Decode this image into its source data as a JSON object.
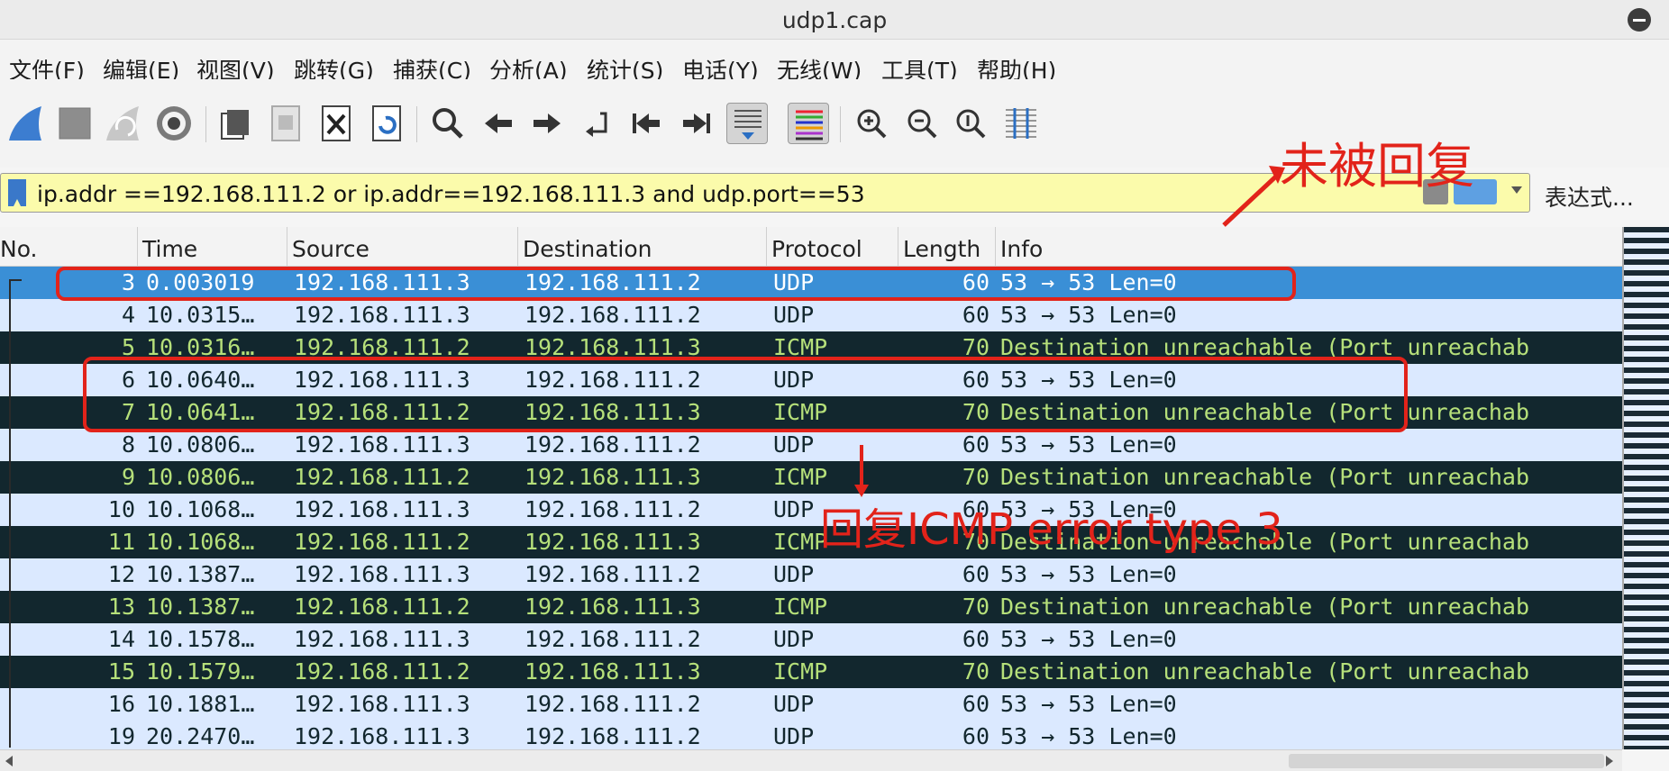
{
  "window": {
    "title": "udp1.cap"
  },
  "menu": [
    "文件(F)",
    "编辑(E)",
    "视图(V)",
    "跳转(G)",
    "捕获(C)",
    "分析(A)",
    "统计(S)",
    "电话(Y)",
    "无线(W)",
    "工具(T)",
    "帮助(H)"
  ],
  "toolbar": [
    "shark-fin-start-icon",
    "stop-square-icon",
    "restart-fin-icon",
    "capture-options-gear-icon",
    "open-folder-icon",
    "save-file-icon",
    "close-file-icon",
    "reload-file-icon",
    "find-search-icon",
    "back-arrow-icon",
    "forward-arrow-icon",
    "go-to-packet-icon",
    "first-packet-icon",
    "last-packet-icon",
    "autoscroll-icon",
    "colorize-icon",
    "zoom-in-icon",
    "zoom-out-icon",
    "zoom-normal-icon",
    "resize-columns-icon"
  ],
  "filter": {
    "value": "ip.addr ==192.168.111.2 or ip.addr==192.168.111.3 and udp.port==53",
    "expression_label": "表达式..."
  },
  "columns": [
    "No.",
    "Time",
    "Source",
    "Destination",
    "Protocol",
    "Length",
    "Info"
  ],
  "packets": [
    {
      "no": "3",
      "time": "0.003019",
      "src": "192.168.111.3",
      "dst": "192.168.111.2",
      "proto": "UDP",
      "len": "60",
      "info": "53 → 53 Len=0",
      "style": "sel"
    },
    {
      "no": "4",
      "time": "10.0315…",
      "src": "192.168.111.3",
      "dst": "192.168.111.2",
      "proto": "UDP",
      "len": "60",
      "info": "53 → 53 Len=0",
      "style": "udp"
    },
    {
      "no": "5",
      "time": "10.0316…",
      "src": "192.168.111.2",
      "dst": "192.168.111.3",
      "proto": "ICMP",
      "len": "70",
      "info": "Destination unreachable (Port unreachab",
      "style": "icmp"
    },
    {
      "no": "6",
      "time": "10.0640…",
      "src": "192.168.111.3",
      "dst": "192.168.111.2",
      "proto": "UDP",
      "len": "60",
      "info": "53 → 53 Len=0",
      "style": "udp"
    },
    {
      "no": "7",
      "time": "10.0641…",
      "src": "192.168.111.2",
      "dst": "192.168.111.3",
      "proto": "ICMP",
      "len": "70",
      "info": "Destination unreachable (Port unreachab",
      "style": "icmp"
    },
    {
      "no": "8",
      "time": "10.0806…",
      "src": "192.168.111.3",
      "dst": "192.168.111.2",
      "proto": "UDP",
      "len": "60",
      "info": "53 → 53 Len=0",
      "style": "udp"
    },
    {
      "no": "9",
      "time": "10.0806…",
      "src": "192.168.111.2",
      "dst": "192.168.111.3",
      "proto": "ICMP",
      "len": "70",
      "info": "Destination unreachable (Port unreachab",
      "style": "icmp"
    },
    {
      "no": "10",
      "time": "10.1068…",
      "src": "192.168.111.3",
      "dst": "192.168.111.2",
      "proto": "UDP",
      "len": "60",
      "info": "53 → 53 Len=0",
      "style": "udp"
    },
    {
      "no": "11",
      "time": "10.1068…",
      "src": "192.168.111.2",
      "dst": "192.168.111.3",
      "proto": "ICMP",
      "len": "70",
      "info": "Destination unreachable (Port unreachab",
      "style": "icmp"
    },
    {
      "no": "12",
      "time": "10.1387…",
      "src": "192.168.111.3",
      "dst": "192.168.111.2",
      "proto": "UDP",
      "len": "60",
      "info": "53 → 53 Len=0",
      "style": "udp"
    },
    {
      "no": "13",
      "time": "10.1387…",
      "src": "192.168.111.2",
      "dst": "192.168.111.3",
      "proto": "ICMP",
      "len": "70",
      "info": "Destination unreachable (Port unreachab",
      "style": "icmp"
    },
    {
      "no": "14",
      "time": "10.1578…",
      "src": "192.168.111.3",
      "dst": "192.168.111.2",
      "proto": "UDP",
      "len": "60",
      "info": "53 → 53 Len=0",
      "style": "udp"
    },
    {
      "no": "15",
      "time": "10.1579…",
      "src": "192.168.111.2",
      "dst": "192.168.111.3",
      "proto": "ICMP",
      "len": "70",
      "info": "Destination unreachable (Port unreachab",
      "style": "icmp"
    },
    {
      "no": "16",
      "time": "10.1881…",
      "src": "192.168.111.3",
      "dst": "192.168.111.2",
      "proto": "UDP",
      "len": "60",
      "info": "53 → 53 Len=0",
      "style": "udp"
    },
    {
      "no": "19",
      "time": "20.2470…",
      "src": "192.168.111.3",
      "dst": "192.168.111.2",
      "proto": "UDP",
      "len": "60",
      "info": "53 → 53 Len=0",
      "style": "udp"
    }
  ],
  "annotations": {
    "not_replied": "未被回复",
    "reply_icmp": "回复ICMP error type 3",
    "color": "#e2231a"
  }
}
